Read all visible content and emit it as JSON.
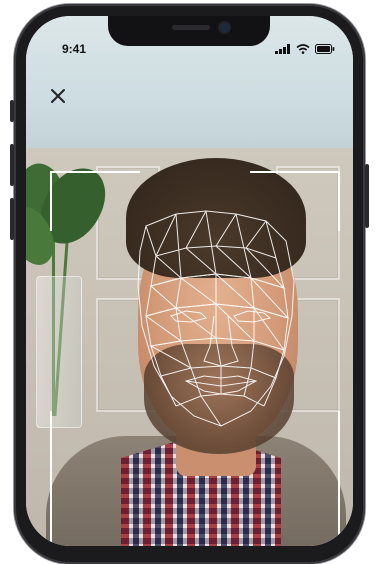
{
  "status_bar": {
    "time": "9:41",
    "icons": [
      "signal-icon",
      "wifi-icon",
      "battery-icon"
    ]
  },
  "toolbar": {
    "close_icon": "close-icon"
  },
  "scan": {
    "frame_color": "#ffffff",
    "mesh_color": "#ffffff"
  },
  "theme": {
    "phone_frame": "#1b1b1d",
    "accent": "#ffffff"
  }
}
